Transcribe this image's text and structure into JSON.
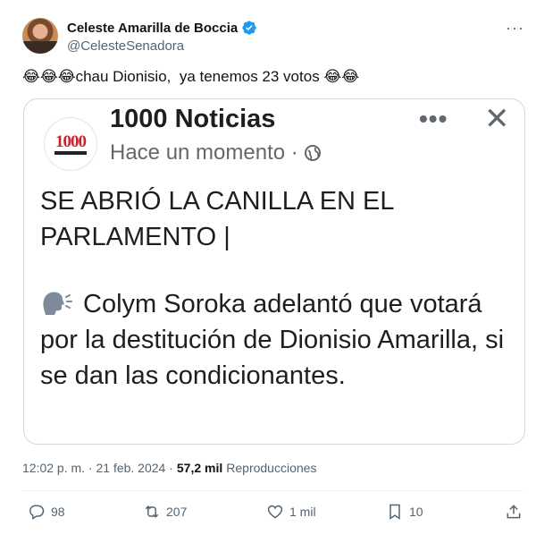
{
  "author": {
    "display_name": "Celeste Amarilla de Boccia",
    "handle": "@CelesteSenadora"
  },
  "tweet": {
    "emoji_prefix": "😂😂😂",
    "text": "chau Dionisio,  ya tenemos 23 votos ",
    "emoji_suffix": "😂😂"
  },
  "media": {
    "logo_number": "1000",
    "page_name": "1000 Noticias",
    "timestamp": "Hace un momento ·",
    "headline": "SE ABRIÓ LA CANILLA EN EL PARLAMENTO |",
    "body": "Colym Soroka adelantó que votará por la destitución de Dionisio Amarilla, si se dan las condicionantes."
  },
  "meta": {
    "time": "12:02 p. m. · 21 feb. 2024 ·",
    "views_count": "57,2 mil",
    "views_label": "Reproducciones"
  },
  "actions": {
    "replies": "98",
    "retweets": "207",
    "likes": "1 mil",
    "bookmarks": "10"
  },
  "icons": [
    "verified-badge-icon",
    "more-icon",
    "globe-icon",
    "speaking-head-icon",
    "close-icon",
    "reply-icon",
    "retweet-icon",
    "like-icon",
    "bookmark-icon",
    "share-icon"
  ],
  "colors": {
    "verified": "#1d9bf0",
    "secondary_text": "#536471",
    "logo_red": "#d0202c"
  }
}
